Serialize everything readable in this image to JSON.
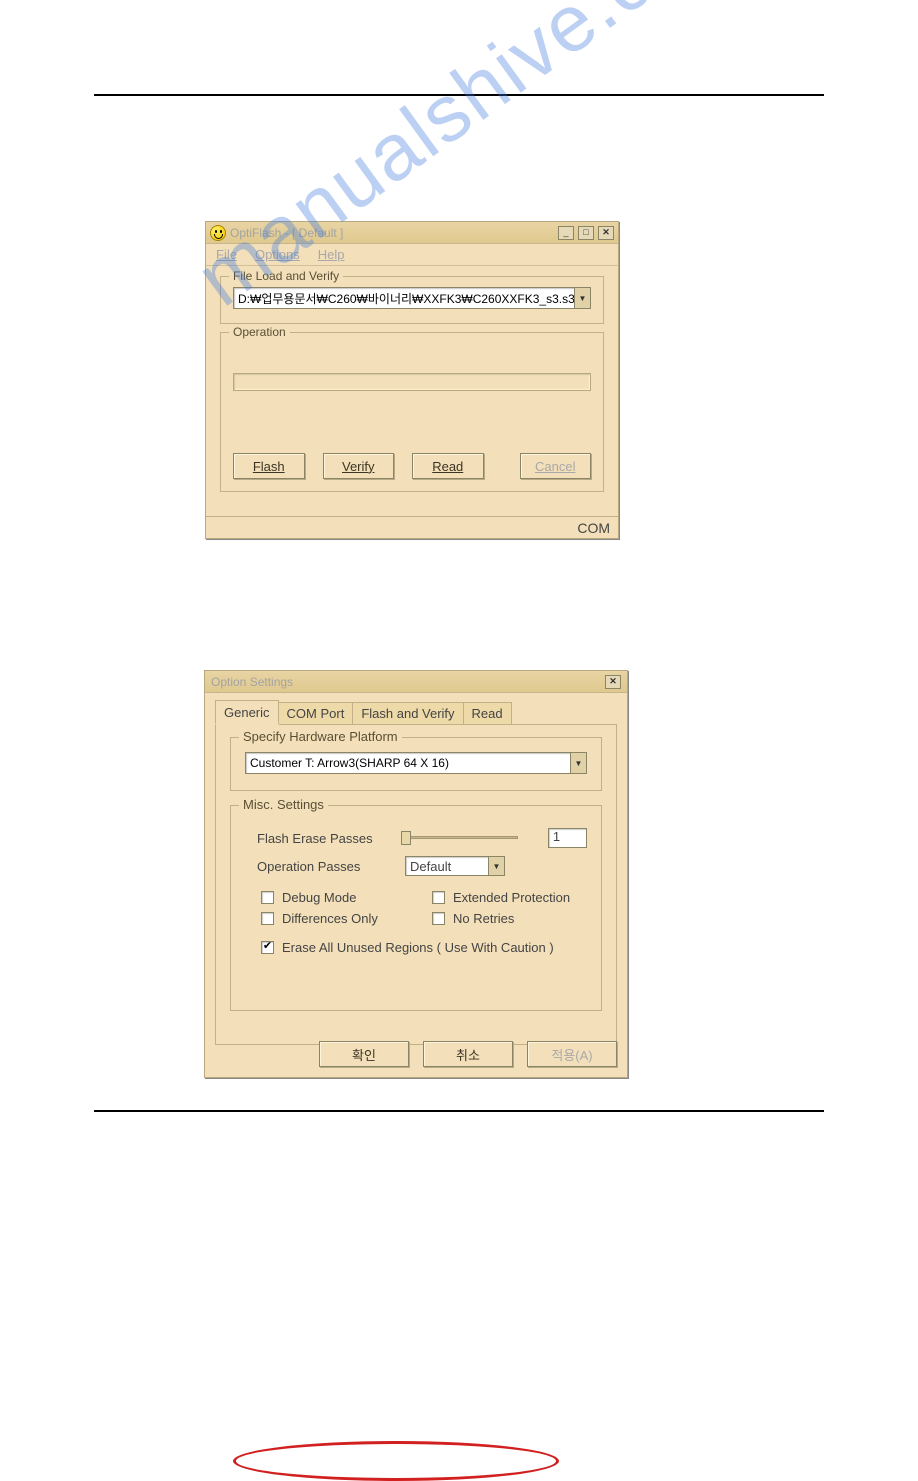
{
  "win1": {
    "title": "OptiFlash - [ Default ]",
    "menu": {
      "file": "File",
      "options": "Options",
      "help": "Help"
    },
    "group_load_legend": "File Load and Verify",
    "path_value": "D:₩업무용문서₩C260₩바이너리₩XXFK3₩C260XXFK3_s3.s3",
    "group_op_legend": "Operation",
    "buttons": {
      "flash": "Flash",
      "verify": "Verify",
      "read": "Read",
      "cancel": "Cancel"
    },
    "status": "COM"
  },
  "win2": {
    "title": "Option Settings",
    "tabs": {
      "generic": "Generic",
      "com": "COM Port",
      "flashverify": "Flash and Verify",
      "read": "Read"
    },
    "grp_platform_legend": "Specify Hardware Platform",
    "platform_value": "Customer T: Arrow3(SHARP 64 X 16)",
    "grp_misc_legend": "Misc. Settings",
    "labels": {
      "flash_erase": "Flash Erase Passes",
      "op_passes": "Operation Passes",
      "debug": "Debug Mode",
      "extprot": "Extended Protection",
      "diffonly": "Differences Only",
      "noretries": "No Retries",
      "eraseall": "Erase All Unused Regions ( Use With Caution )"
    },
    "flash_erase_value": "1",
    "op_passes_value": "Default",
    "buttons": {
      "ok": "확인",
      "cancel": "취소",
      "apply": "적용(A)"
    }
  },
  "watermark": "manualshive.com"
}
